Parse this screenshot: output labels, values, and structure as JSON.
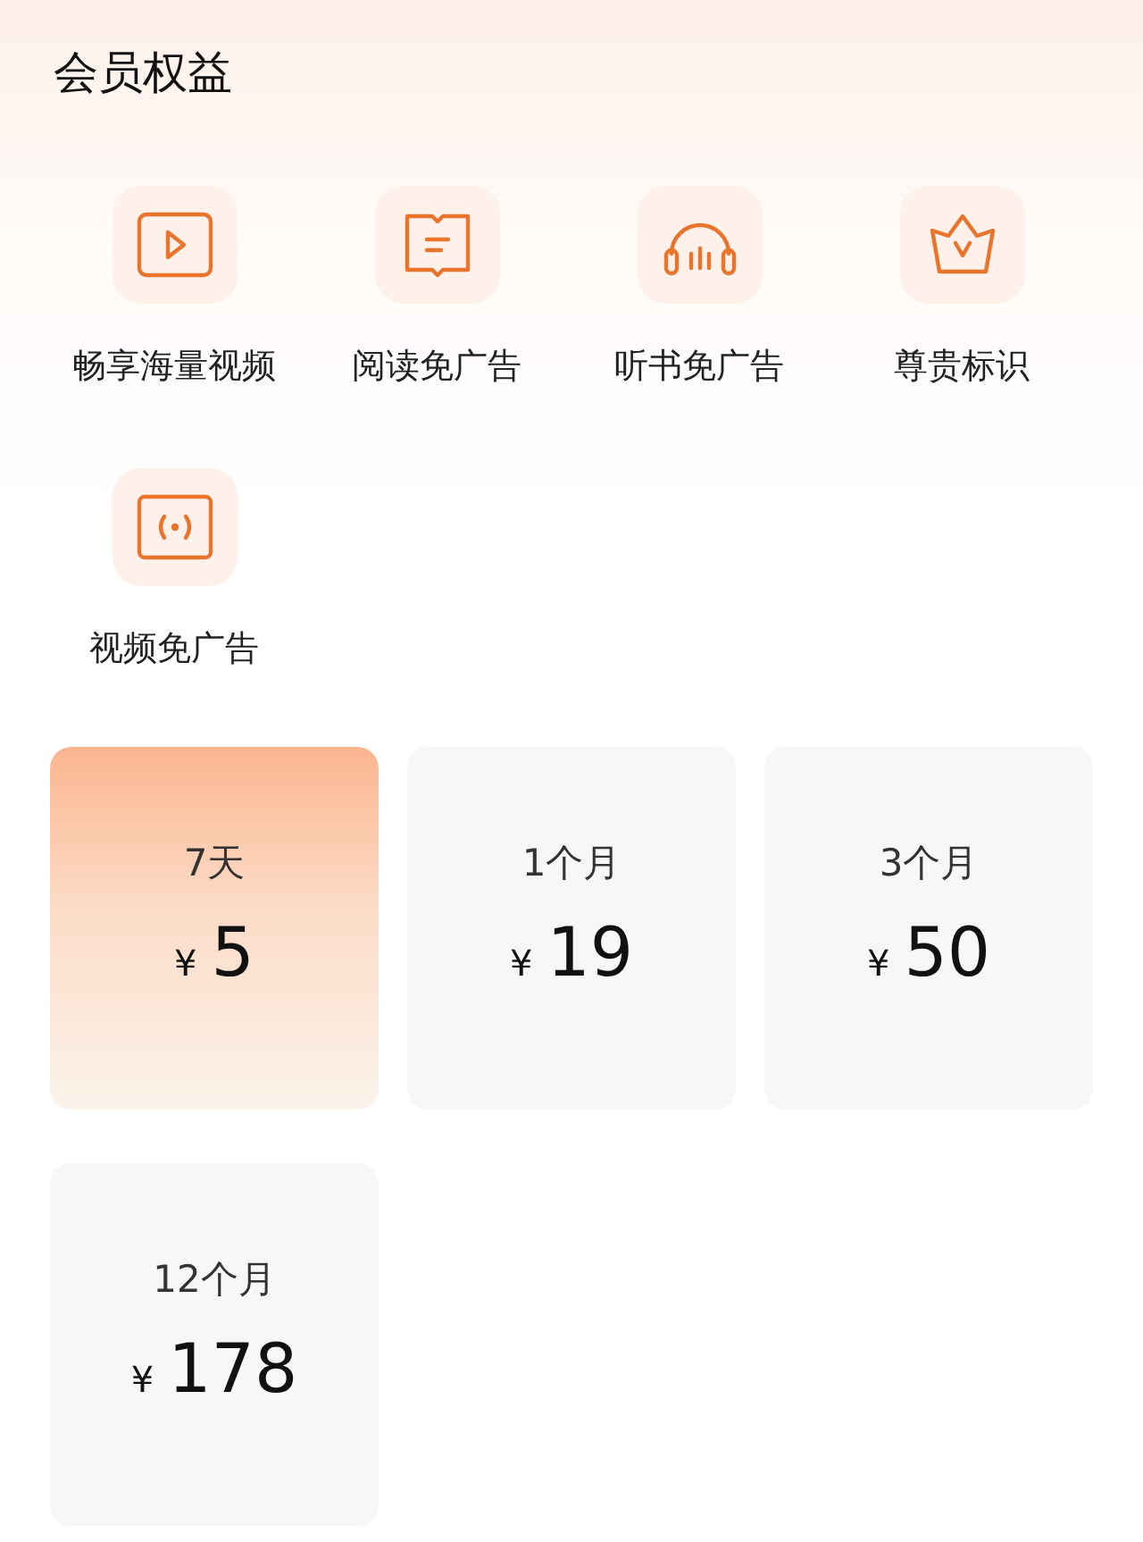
{
  "title": "会员权益",
  "benefits": [
    {
      "kind": "video",
      "label": "畅享海量视频"
    },
    {
      "kind": "book",
      "label": "阅读免广告"
    },
    {
      "kind": "headphones",
      "label": "听书免广告"
    },
    {
      "kind": "crown",
      "label": "尊贵标识"
    },
    {
      "kind": "broadcast",
      "label": "视频免广告"
    }
  ],
  "plans": [
    {
      "duration": "7天",
      "currency": "¥",
      "price": "5",
      "selected": true
    },
    {
      "duration": "1个月",
      "currency": "¥",
      "price": "19",
      "selected": false
    },
    {
      "duration": "3个月",
      "currency": "¥",
      "price": "50",
      "selected": false
    },
    {
      "duration": "12个月",
      "currency": "¥",
      "price": "178",
      "selected": false
    }
  ]
}
